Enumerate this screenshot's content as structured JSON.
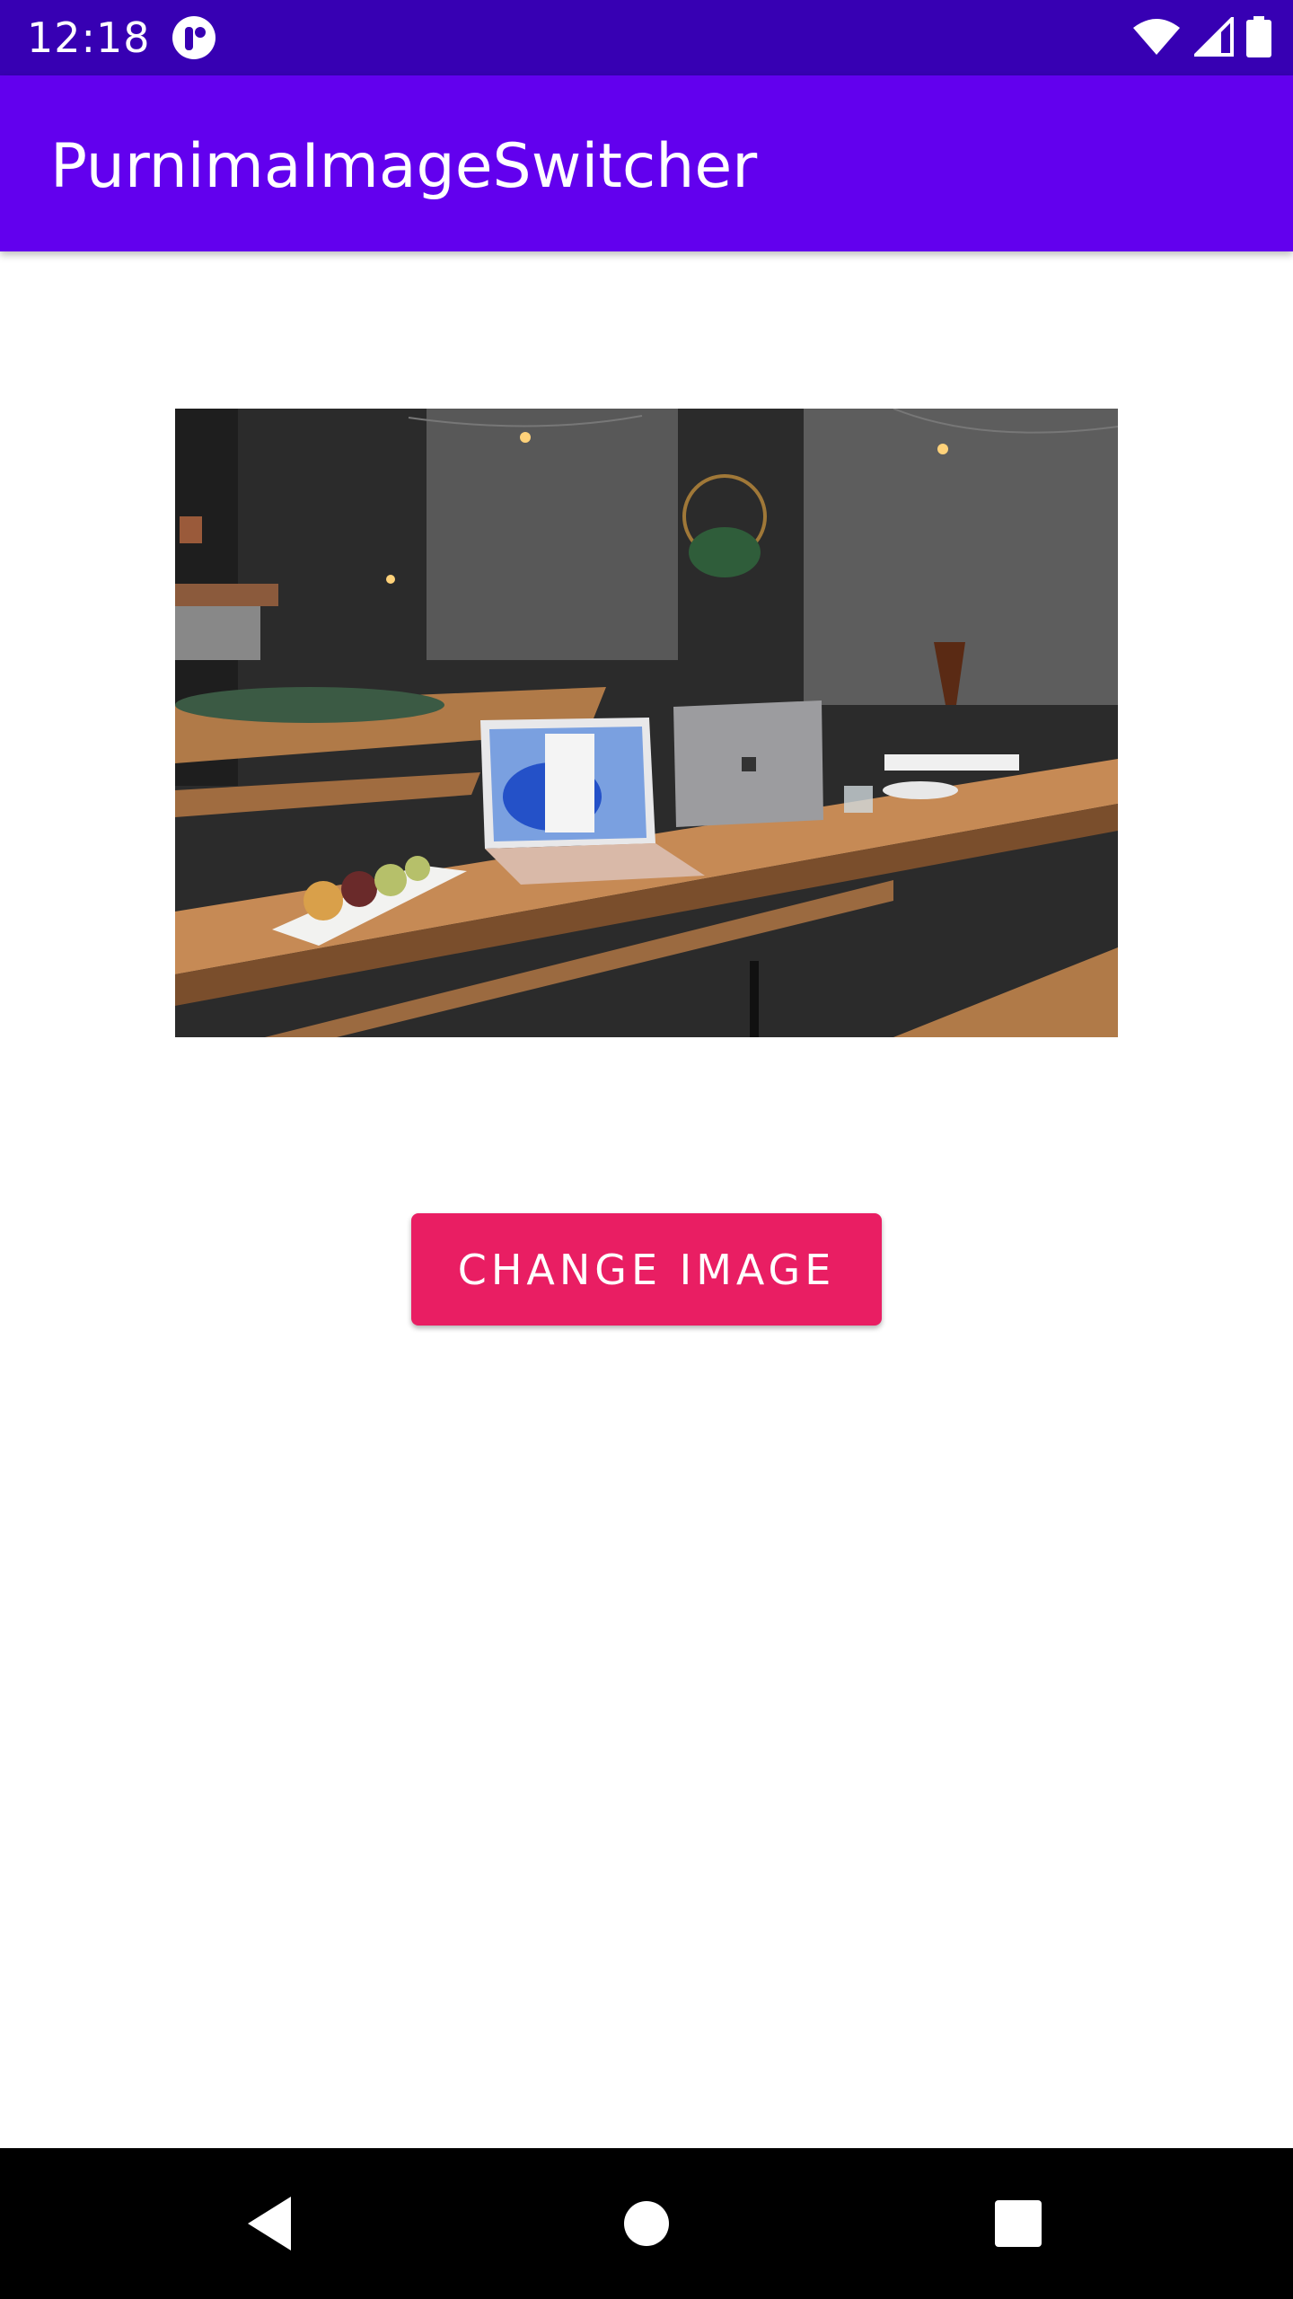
{
  "status_bar": {
    "time": "12:18",
    "icons": [
      "app-notification-icon",
      "wifi-icon",
      "cell-signal-icon",
      "battery-icon"
    ]
  },
  "app_bar": {
    "title": "PurnimaImageSwitcher"
  },
  "image_switcher": {
    "image": "cafe-table-with-laptops-photo"
  },
  "buttons": {
    "change_image_label": "CHANGE IMAGE"
  },
  "nav_bar": {
    "icons": [
      "back-icon",
      "home-icon",
      "recents-icon"
    ]
  },
  "colors": {
    "status_bar": "#3700b3",
    "app_bar": "#6200ee",
    "button": "#e91e63",
    "nav_bar": "#000000",
    "background": "#ffffff"
  }
}
